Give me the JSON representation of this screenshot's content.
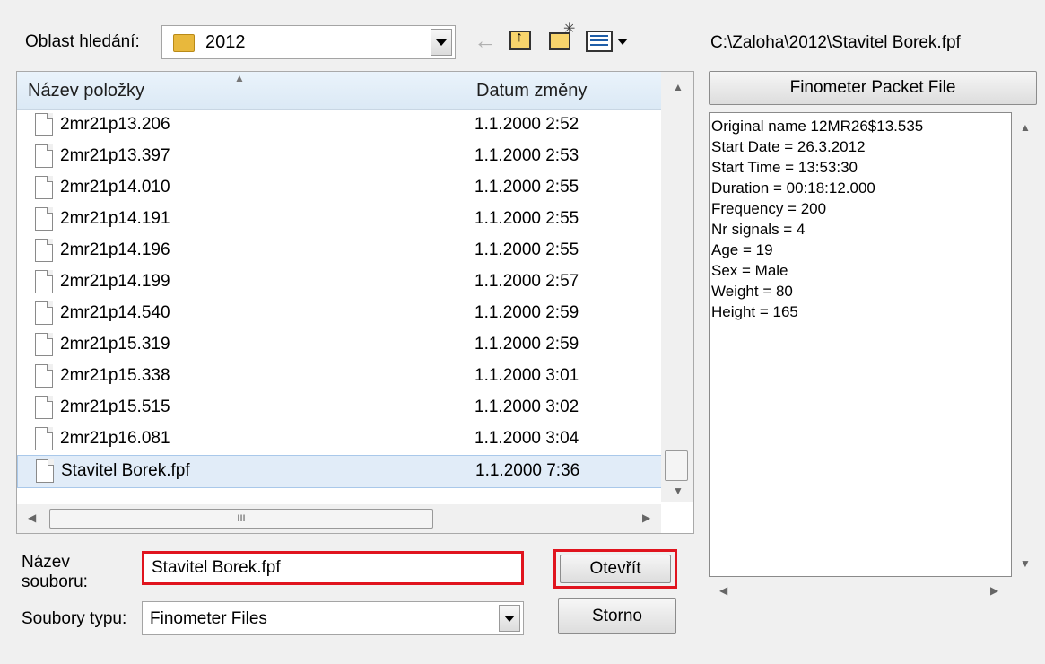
{
  "lookin": {
    "label": "Oblast hledání:",
    "value": "2012"
  },
  "toolbar": {
    "back_icon": "back-arrow-icon",
    "up_icon": "up-folder-icon",
    "new_icon": "new-folder-icon",
    "view_icon": "view-menu-icon"
  },
  "path": "C:\\Zaloha\\2012\\Stavitel Borek.fpf",
  "columns": {
    "name": "Název položky",
    "date": "Datum změny"
  },
  "files": [
    {
      "name": "2mr21p13.206",
      "date": "1.1.2000 2:52"
    },
    {
      "name": "2mr21p13.397",
      "date": "1.1.2000 2:53"
    },
    {
      "name": "2mr21p14.010",
      "date": "1.1.2000 2:55"
    },
    {
      "name": "2mr21p14.191",
      "date": "1.1.2000 2:55"
    },
    {
      "name": "2mr21p14.196",
      "date": "1.1.2000 2:55"
    },
    {
      "name": "2mr21p14.199",
      "date": "1.1.2000 2:57"
    },
    {
      "name": "2mr21p14.540",
      "date": "1.1.2000 2:59"
    },
    {
      "name": "2mr21p15.319",
      "date": "1.1.2000 2:59"
    },
    {
      "name": "2mr21p15.338",
      "date": "1.1.2000 3:01"
    },
    {
      "name": "2mr21p15.515",
      "date": "1.1.2000 3:02"
    },
    {
      "name": "2mr21p16.081",
      "date": "1.1.2000 3:04"
    },
    {
      "name": "Stavitel Borek.fpf",
      "date": "1.1.2000 7:36"
    }
  ],
  "hscroll_grip": "III",
  "filename": {
    "label_line1": "Název",
    "label_line2": "souboru:",
    "value": "Stavitel Borek.fpf"
  },
  "filetype": {
    "label": "Soubory typu:",
    "value": "Finometer Files"
  },
  "buttons": {
    "open": "Otevřít",
    "cancel": "Storno"
  },
  "preview": {
    "header": "Finometer Packet File",
    "lines": [
      "Original name 12MR26$13.535",
      "Start Date = 26.3.2012",
      "Start Time = 13:53:30",
      "Duration = 00:18:12.000",
      "Frequency = 200",
      "Nr signals = 4",
      "Age = 19",
      "Sex = Male",
      "Weight = 80",
      "Height = 165"
    ]
  },
  "colors": {
    "highlight_border": "#e0141e",
    "selection": "#e1ecf8"
  }
}
